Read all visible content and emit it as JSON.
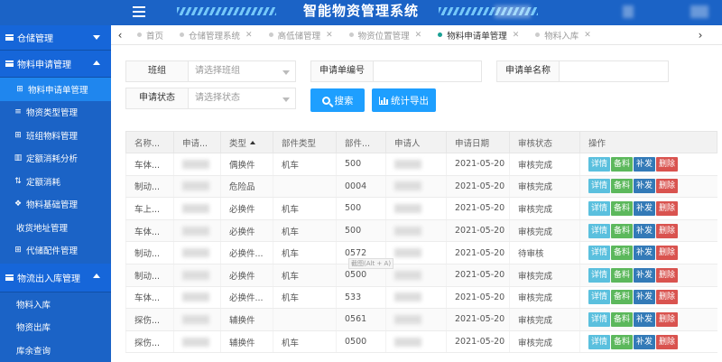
{
  "header": {
    "title": "智能物资管理系统"
  },
  "tabs": {
    "items": [
      {
        "label": "首页",
        "closable": false
      },
      {
        "label": "仓储管理系统",
        "closable": true
      },
      {
        "label": "高低储管理",
        "closable": true
      },
      {
        "label": "物资位置管理",
        "closable": true
      },
      {
        "label": "物料申请单管理",
        "closable": true,
        "active": true
      },
      {
        "label": "物料入库",
        "closable": true
      }
    ],
    "left_arrow": "‹",
    "right_arrow": "›"
  },
  "sidebar": {
    "group1": "仓储管理",
    "group2": "物料申请管理",
    "items": [
      "物料申请单管理",
      "物资类型管理",
      "班组物料管理",
      "定额消耗分析",
      "定额消耗",
      "物料基础管理",
      "收货地址管理",
      "代储配件管理"
    ],
    "group3": "物流出入库管理",
    "items2": [
      "物料入库",
      "物资出库",
      "库余查询"
    ]
  },
  "filters": {
    "team_label": "班组",
    "team_placeholder": "请选择班组",
    "number_label": "申请单编号",
    "name_label": "申请单名称",
    "status_label": "申请状态",
    "status_placeholder": "请选择状态",
    "search_button": "搜索",
    "export_button": "统计导出"
  },
  "table": {
    "columns": [
      "名称...",
      "申请...",
      "类型",
      "部件类型",
      "部件...",
      "申请人",
      "申请日期",
      "审核状态",
      "操作"
    ],
    "ops": {
      "detail": "详情",
      "prepare": "备料",
      "supply": "补发",
      "delete": "删除"
    },
    "rows": [
      {
        "name": "车体...",
        "type": "偶换件",
        "part_type": "机车",
        "part_no": "500",
        "date": "2021-05-20",
        "status": "审核完成"
      },
      {
        "name": "制动...",
        "type": "危险品",
        "part_type": "",
        "part_no": "0004",
        "date": "2021-05-20",
        "status": "审核完成"
      },
      {
        "name": "车上...",
        "type": "必换件",
        "part_type": "机车",
        "part_no": "500",
        "date": "2021-05-20",
        "status": "审核完成"
      },
      {
        "name": "车体...",
        "type": "必换件",
        "part_type": "机车",
        "part_no": "500",
        "date": "2021-05-20",
        "status": "审核完成"
      },
      {
        "name": "制动...",
        "type": "必换件...",
        "part_type": "机车",
        "part_no": "0572",
        "date": "2021-05-20",
        "status": "待审核"
      },
      {
        "name": "制动...",
        "type": "必换件",
        "part_type": "机车",
        "part_no": "0500",
        "date": "2021-05-20",
        "status": "审核完成"
      },
      {
        "name": "车体...",
        "type": "必换件...",
        "part_type": "机车",
        "part_no": "533",
        "date": "2021-05-20",
        "status": "审核完成"
      },
      {
        "name": "探伤...",
        "type": "辅换件",
        "part_type": "",
        "part_no": "0561",
        "date": "2021-05-20",
        "status": "审核完成"
      },
      {
        "name": "探伤...",
        "type": "辅换件",
        "part_type": "机车",
        "part_no": "0500",
        "date": "2021-05-20",
        "status": "审核完成"
      }
    ]
  },
  "tooltip": "截图(Alt + A)"
}
